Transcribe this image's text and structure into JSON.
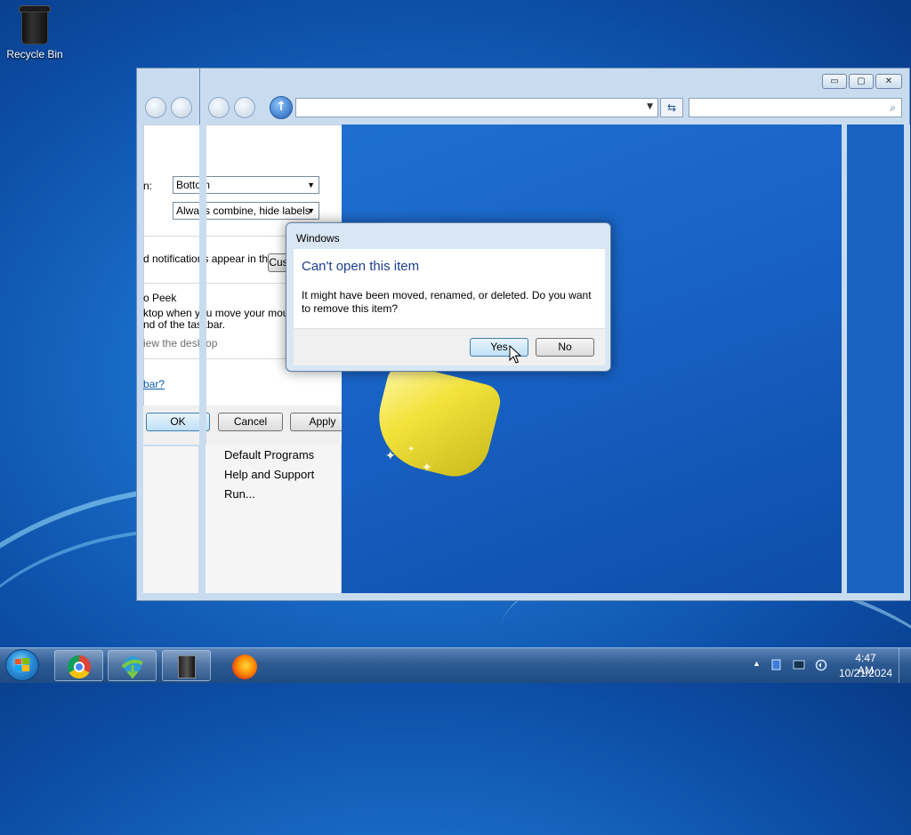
{
  "desktop": {
    "icons": [
      {
        "label": "Recycle Bin",
        "icon": "recycle-bin-icon"
      }
    ]
  },
  "explorer": {
    "caption": {
      "minimize": "▭",
      "restore": "▢",
      "close": "✕"
    },
    "start_menu_items": [
      "Default Programs",
      "Help and Support",
      "Run..."
    ]
  },
  "taskbar_properties": {
    "location_label": "n:",
    "location_value": "Bottom",
    "buttons_value": "Always combine, hide labels",
    "notification_text": "d notifications appear in the",
    "customize_label": "Cus",
    "peek_heading": "o Peek",
    "peek_line1": "ktop when you move your mouse",
    "peek_line2": "nd of the taskbar.",
    "peek_checkbox_label": "iew the desktop",
    "help_link": "bar?",
    "ok": "OK",
    "cancel": "Cancel",
    "apply": "Apply"
  },
  "dialog": {
    "title": "Windows",
    "heading": "Can't open this item",
    "message": "It might have been moved, renamed, or deleted. Do you want to remove this item?",
    "yes": "Yes",
    "no": "No"
  },
  "taskbar": {
    "pinned": [
      {
        "name": "chrome",
        "icon": "chrome-icon"
      },
      {
        "name": "internet-download-manager",
        "icon": "idm-icon"
      },
      {
        "name": "virtualbox",
        "icon": "cube-icon"
      },
      {
        "name": "firefox",
        "icon": "firefox-icon"
      }
    ],
    "tray": {
      "show_hidden": "▲",
      "time": "4:47 AM",
      "date": "10/21/2024"
    }
  },
  "colors": {
    "desktop_blue": "#1a6fc8",
    "dialog_heading": "#1e3e8c",
    "link": "#0b5cad",
    "taskbar": "#2d5a92"
  }
}
